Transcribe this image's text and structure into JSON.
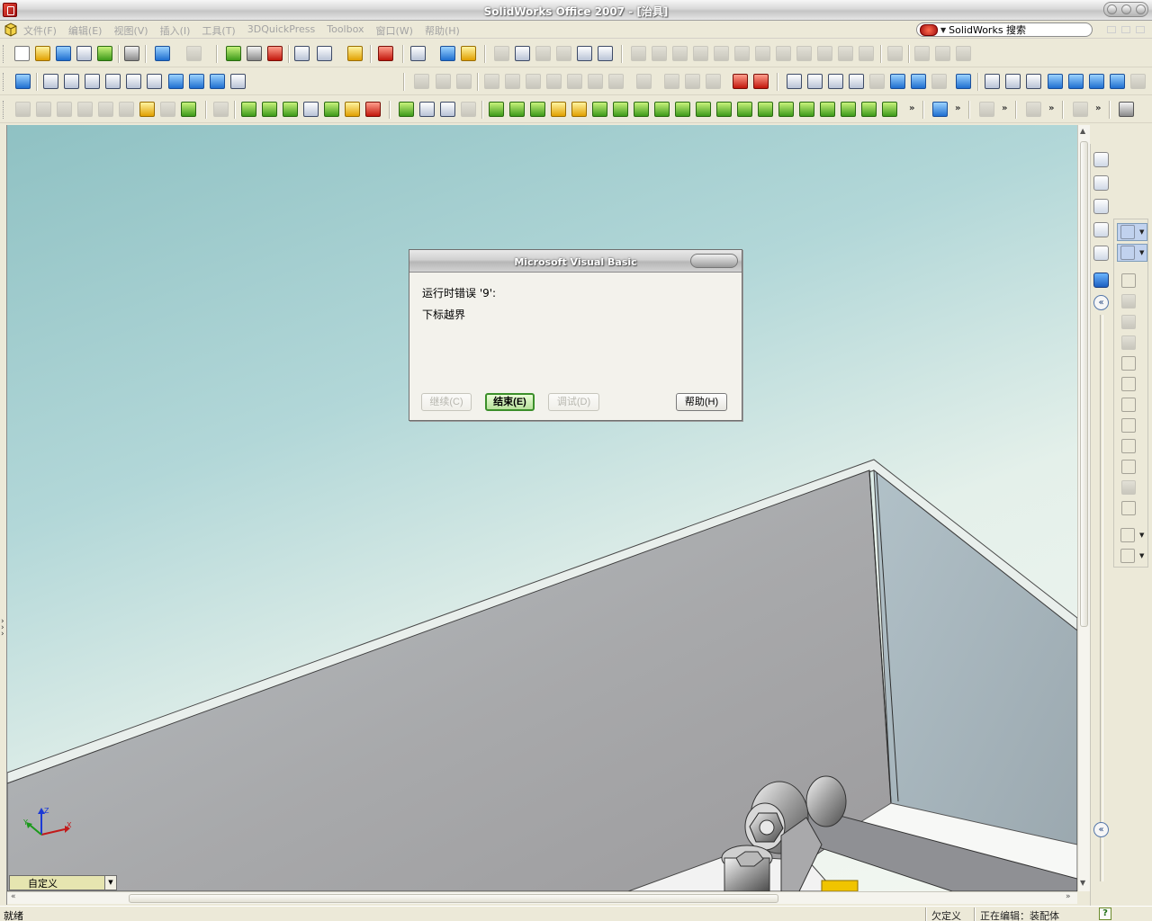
{
  "window": {
    "title": "SolidWorks Office 2007 - [治具]"
  },
  "menu": {
    "items": [
      "文件(F)",
      "编辑(E)",
      "视图(V)",
      "插入(I)",
      "工具(T)",
      "3DQuickPress",
      "Toolbox",
      "窗口(W)",
      "帮助(H)"
    ]
  },
  "search": {
    "label": "SolidWorks 搜索"
  },
  "dialog": {
    "title": "Microsoft Visual Basic",
    "error_line": "运行时错误 '9':",
    "message": "下标越界",
    "buttons": {
      "continue": "继续(C)",
      "end": "结束(E)",
      "debug": "调试(D)",
      "help": "帮助(H)"
    }
  },
  "view": {
    "orientation_value": "自定义",
    "triad_axes": [
      "X",
      "Y",
      "Z"
    ]
  },
  "status": {
    "left": "就绪",
    "definition": "欠定义",
    "editing": "正在编辑：装配体",
    "help_glyph": "?"
  },
  "colors": {
    "viewport_top": "#8fc1c3",
    "viewport_bottom": "#f3f7f1",
    "default_button": "#3b8f2a"
  }
}
